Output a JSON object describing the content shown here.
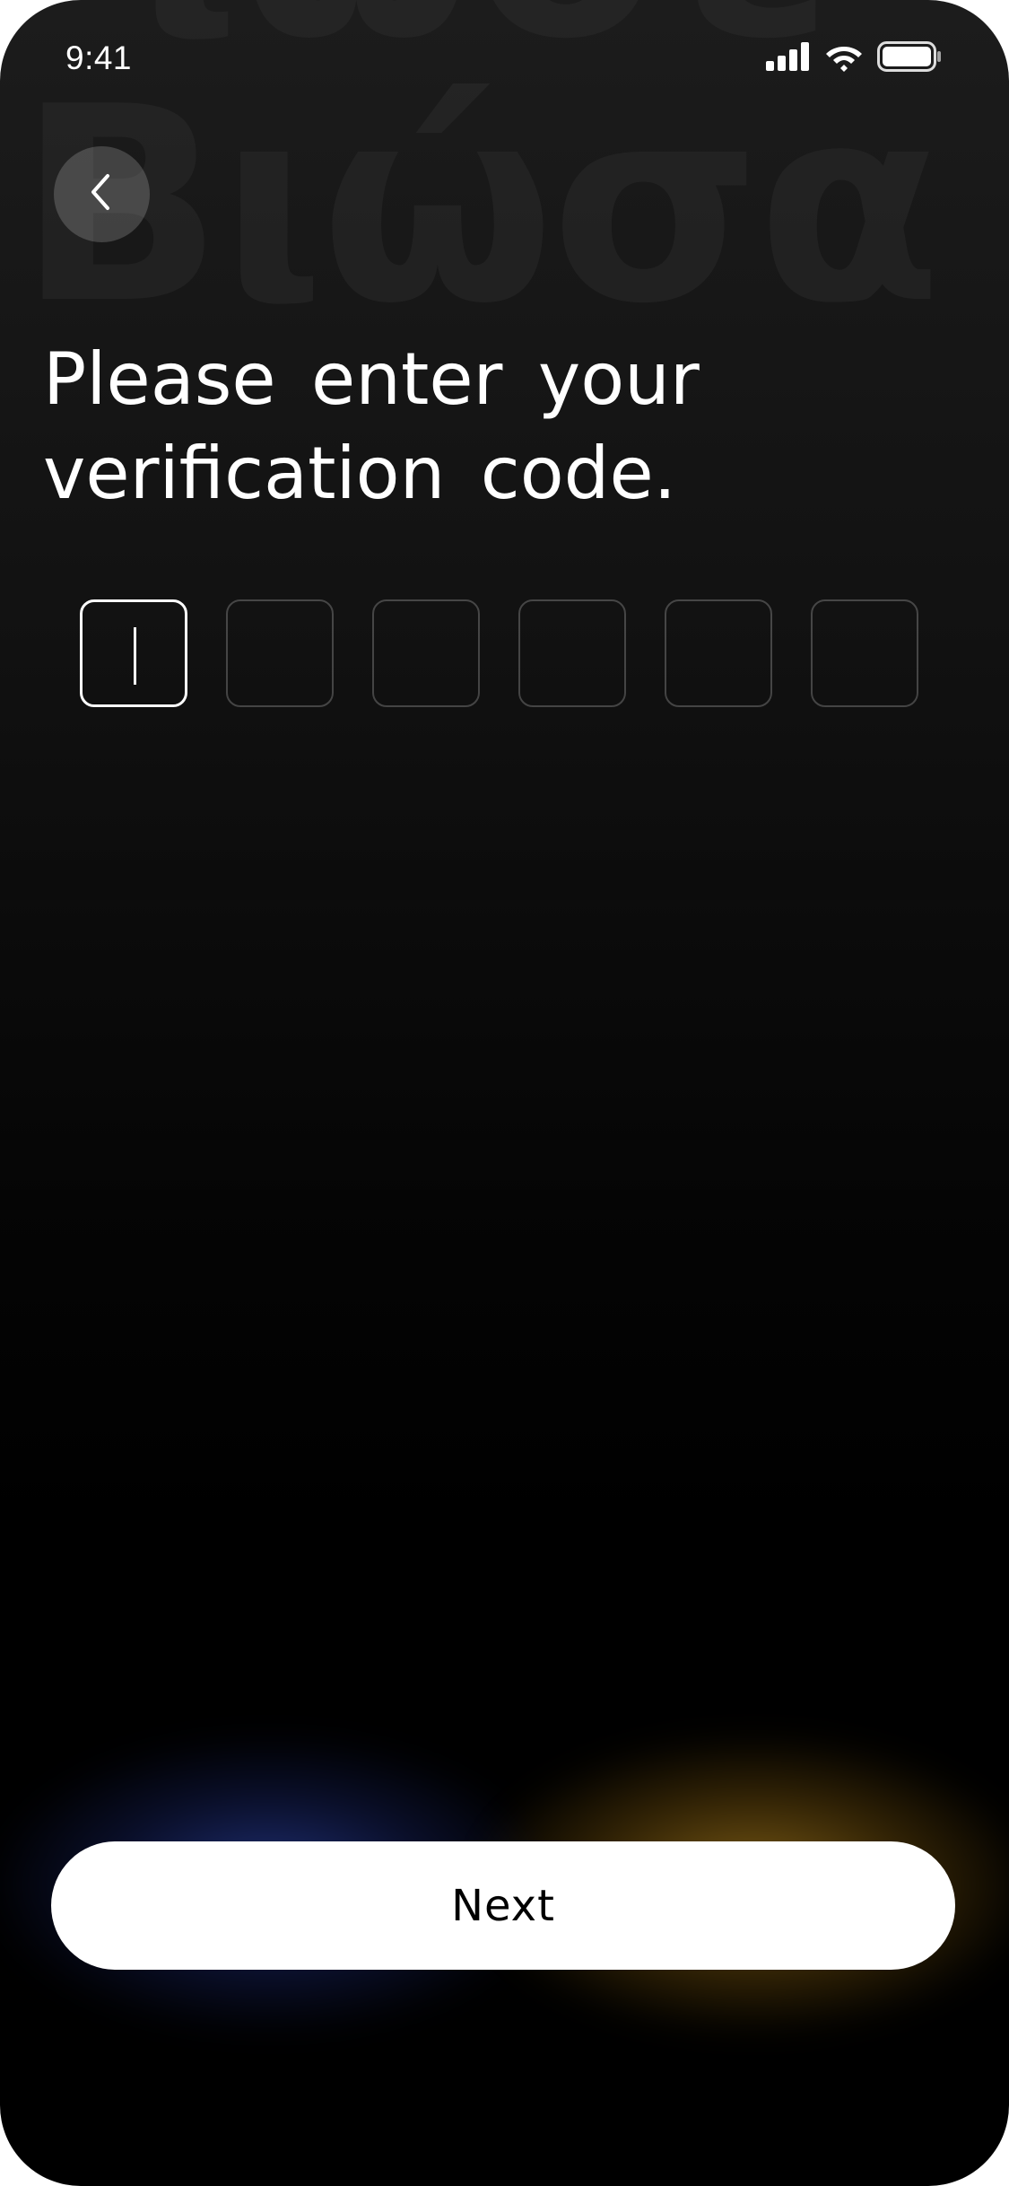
{
  "status_bar": {
    "time": "9:41",
    "icons": [
      "cellular-signal-icon",
      "wifi-icon",
      "battery-icon"
    ]
  },
  "background": {
    "decorative_word_top": "ιώσε",
    "decorative_word": "Βιώσα"
  },
  "header": {
    "back_icon": "chevron-left-icon",
    "title_line1": "Please enter your",
    "title_line2": "verification code."
  },
  "verification": {
    "digit_count": 6,
    "active_index": 0,
    "values": [
      "",
      "",
      "",
      "",
      "",
      ""
    ]
  },
  "footer": {
    "next_label": "Next"
  },
  "colors": {
    "background": "#000000",
    "text": "#ffffff",
    "button_bg": "#ffffff",
    "button_text": "#000000",
    "glow_blue": "#3c5adc",
    "glow_gold": "#e6aa28"
  }
}
